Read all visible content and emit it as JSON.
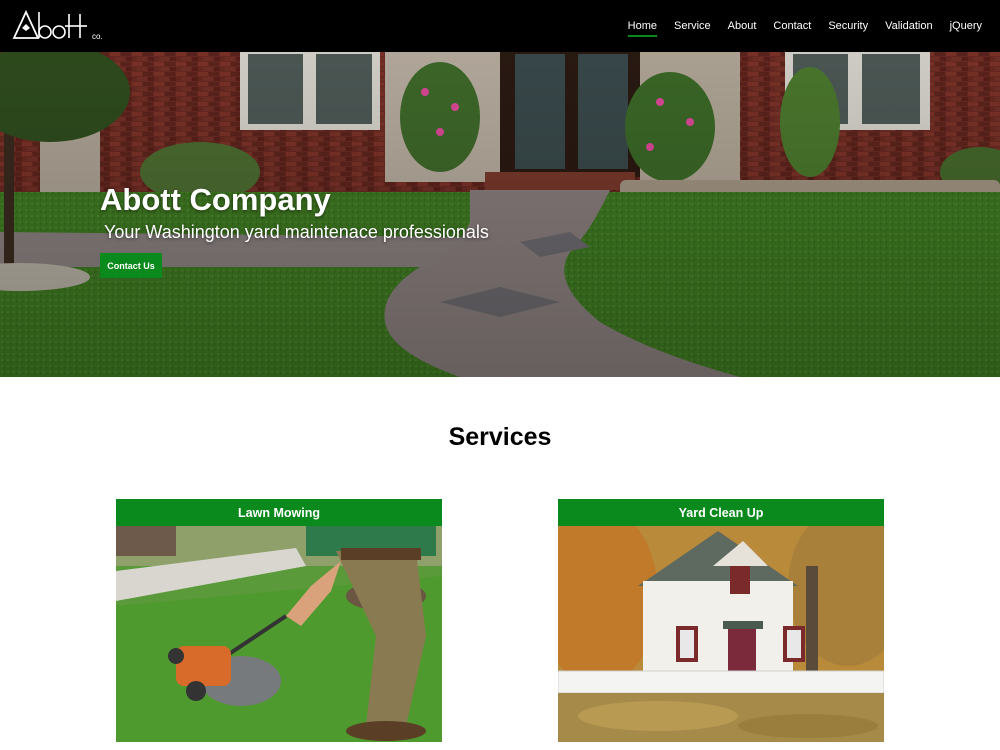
{
  "brand": {
    "logo_text": "Abott",
    "logo_suffix": "co."
  },
  "nav": {
    "items": [
      {
        "label": "Home",
        "active": true
      },
      {
        "label": "Service"
      },
      {
        "label": "About"
      },
      {
        "label": "Contact"
      },
      {
        "label": "Security"
      },
      {
        "label": "Validation"
      },
      {
        "label": "jQuery"
      }
    ]
  },
  "hero": {
    "title": "Abott Company",
    "subtitle": "Your Washington yard maintenace professionals",
    "button_label": "Contact Us"
  },
  "services": {
    "heading": "Services",
    "cards": [
      {
        "title": "Lawn Mowing"
      },
      {
        "title": "Yard Clean Up"
      }
    ]
  },
  "colors": {
    "accent": "#0a8a1c",
    "nav_bg": "#000000"
  }
}
